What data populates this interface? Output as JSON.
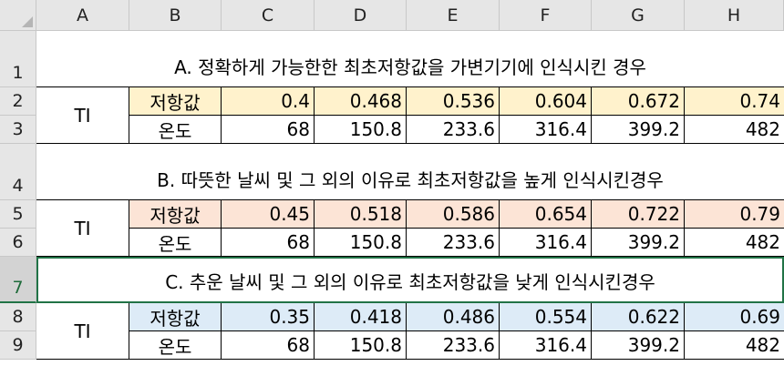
{
  "columns": [
    "A",
    "B",
    "C",
    "D",
    "E",
    "F",
    "G",
    "H"
  ],
  "rows": [
    "1",
    "2",
    "3",
    "4",
    "5",
    "6",
    "7",
    "8",
    "9"
  ],
  "sections": [
    {
      "title": "A. 정확하게 가능한한 최초저항값을 가변기기에 인식시킨 경우",
      "label": "TI",
      "resistance_label": "저항값",
      "temperature_label": "온도",
      "resistance": [
        "0.4",
        "0.468",
        "0.536",
        "0.604",
        "0.672",
        "0.74"
      ],
      "temperature": [
        "68",
        "150.8",
        "233.6",
        "316.4",
        "399.2",
        "482"
      ],
      "highlight": "#fff2cc"
    },
    {
      "title": "B. 따뜻한 날씨 및 그 외의 이유로 최초저항값을 높게 인식시킨경우",
      "label": "TI",
      "resistance_label": "저항값",
      "temperature_label": "온도",
      "resistance": [
        "0.45",
        "0.518",
        "0.586",
        "0.654",
        "0.722",
        "0.79"
      ],
      "temperature": [
        "68",
        "150.8",
        "233.6",
        "316.4",
        "399.2",
        "482"
      ],
      "highlight": "#fce4d6"
    },
    {
      "title": "C. 추운 날씨 및 그 외의 이유로 최초저항값을 낮게 인식시킨경우",
      "label": "TI",
      "resistance_label": "저항값",
      "temperature_label": "온도",
      "resistance": [
        "0.35",
        "0.418",
        "0.486",
        "0.554",
        "0.622",
        "0.69"
      ],
      "temperature": [
        "68",
        "150.8",
        "233.6",
        "316.4",
        "399.2",
        "482"
      ],
      "highlight": "#ddebf7"
    }
  ]
}
